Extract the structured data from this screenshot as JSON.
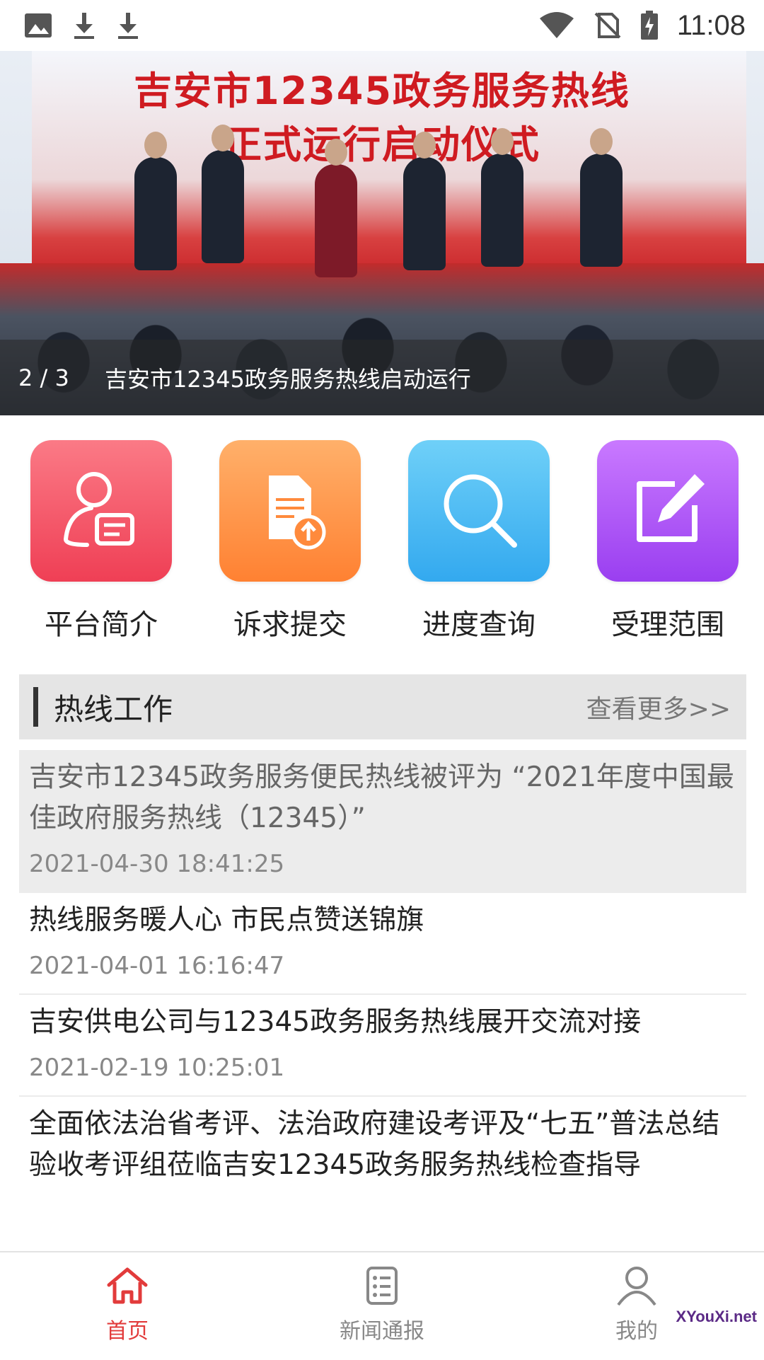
{
  "status_bar": {
    "time": "11:08",
    "left_icons": [
      "image-icon",
      "download-icon",
      "download-icon"
    ],
    "right_icons": [
      "wifi-icon",
      "no-sim-icon",
      "battery-charging-icon"
    ]
  },
  "banner": {
    "headline_line1": "吉安市12345政务服务热线",
    "headline_line2": "正式运行启动仪式",
    "page_indicator": "2 / 3",
    "caption": "吉安市12345政务服务热线启动运行"
  },
  "quick_actions": [
    {
      "label": "平台简介",
      "icon": "user-card-icon",
      "color": "#ef3f55"
    },
    {
      "label": "诉求提交",
      "icon": "document-upload-icon",
      "color": "#ff8132"
    },
    {
      "label": "进度查询",
      "icon": "search-icon",
      "color": "#33a9ef"
    },
    {
      "label": "受理范围",
      "icon": "edit-icon",
      "color": "#9a3ff0"
    }
  ],
  "section": {
    "title": "热线工作",
    "more_link": "查看更多>>"
  },
  "news": [
    {
      "title": "吉安市12345政务服务便民热线被评为 “2021年度中国最佳政府服务热线（12345）”",
      "date": "2021-04-30 18:41:25"
    },
    {
      "title": "热线服务暖人心 市民点赞送锦旗",
      "date": "2021-04-01 16:16:47"
    },
    {
      "title": "吉安供电公司与12345政务服务热线展开交流对接",
      "date": "2021-02-19 10:25:01"
    },
    {
      "title": "全面依法治省考评、法治政府建设考评及“七五”普法总结验收考评组莅临吉安12345政务服务热线检查指导",
      "date": ""
    }
  ],
  "bottom_nav": [
    {
      "label": "首页",
      "icon": "home-icon",
      "active": true
    },
    {
      "label": "新闻通报",
      "icon": "news-list-icon",
      "active": false
    },
    {
      "label": "我的",
      "icon": "profile-icon",
      "active": false
    }
  ],
  "colors": {
    "accent_red": "#e23b3b",
    "section_bg": "#e5e5e5"
  },
  "watermark": "XYouXi.net"
}
